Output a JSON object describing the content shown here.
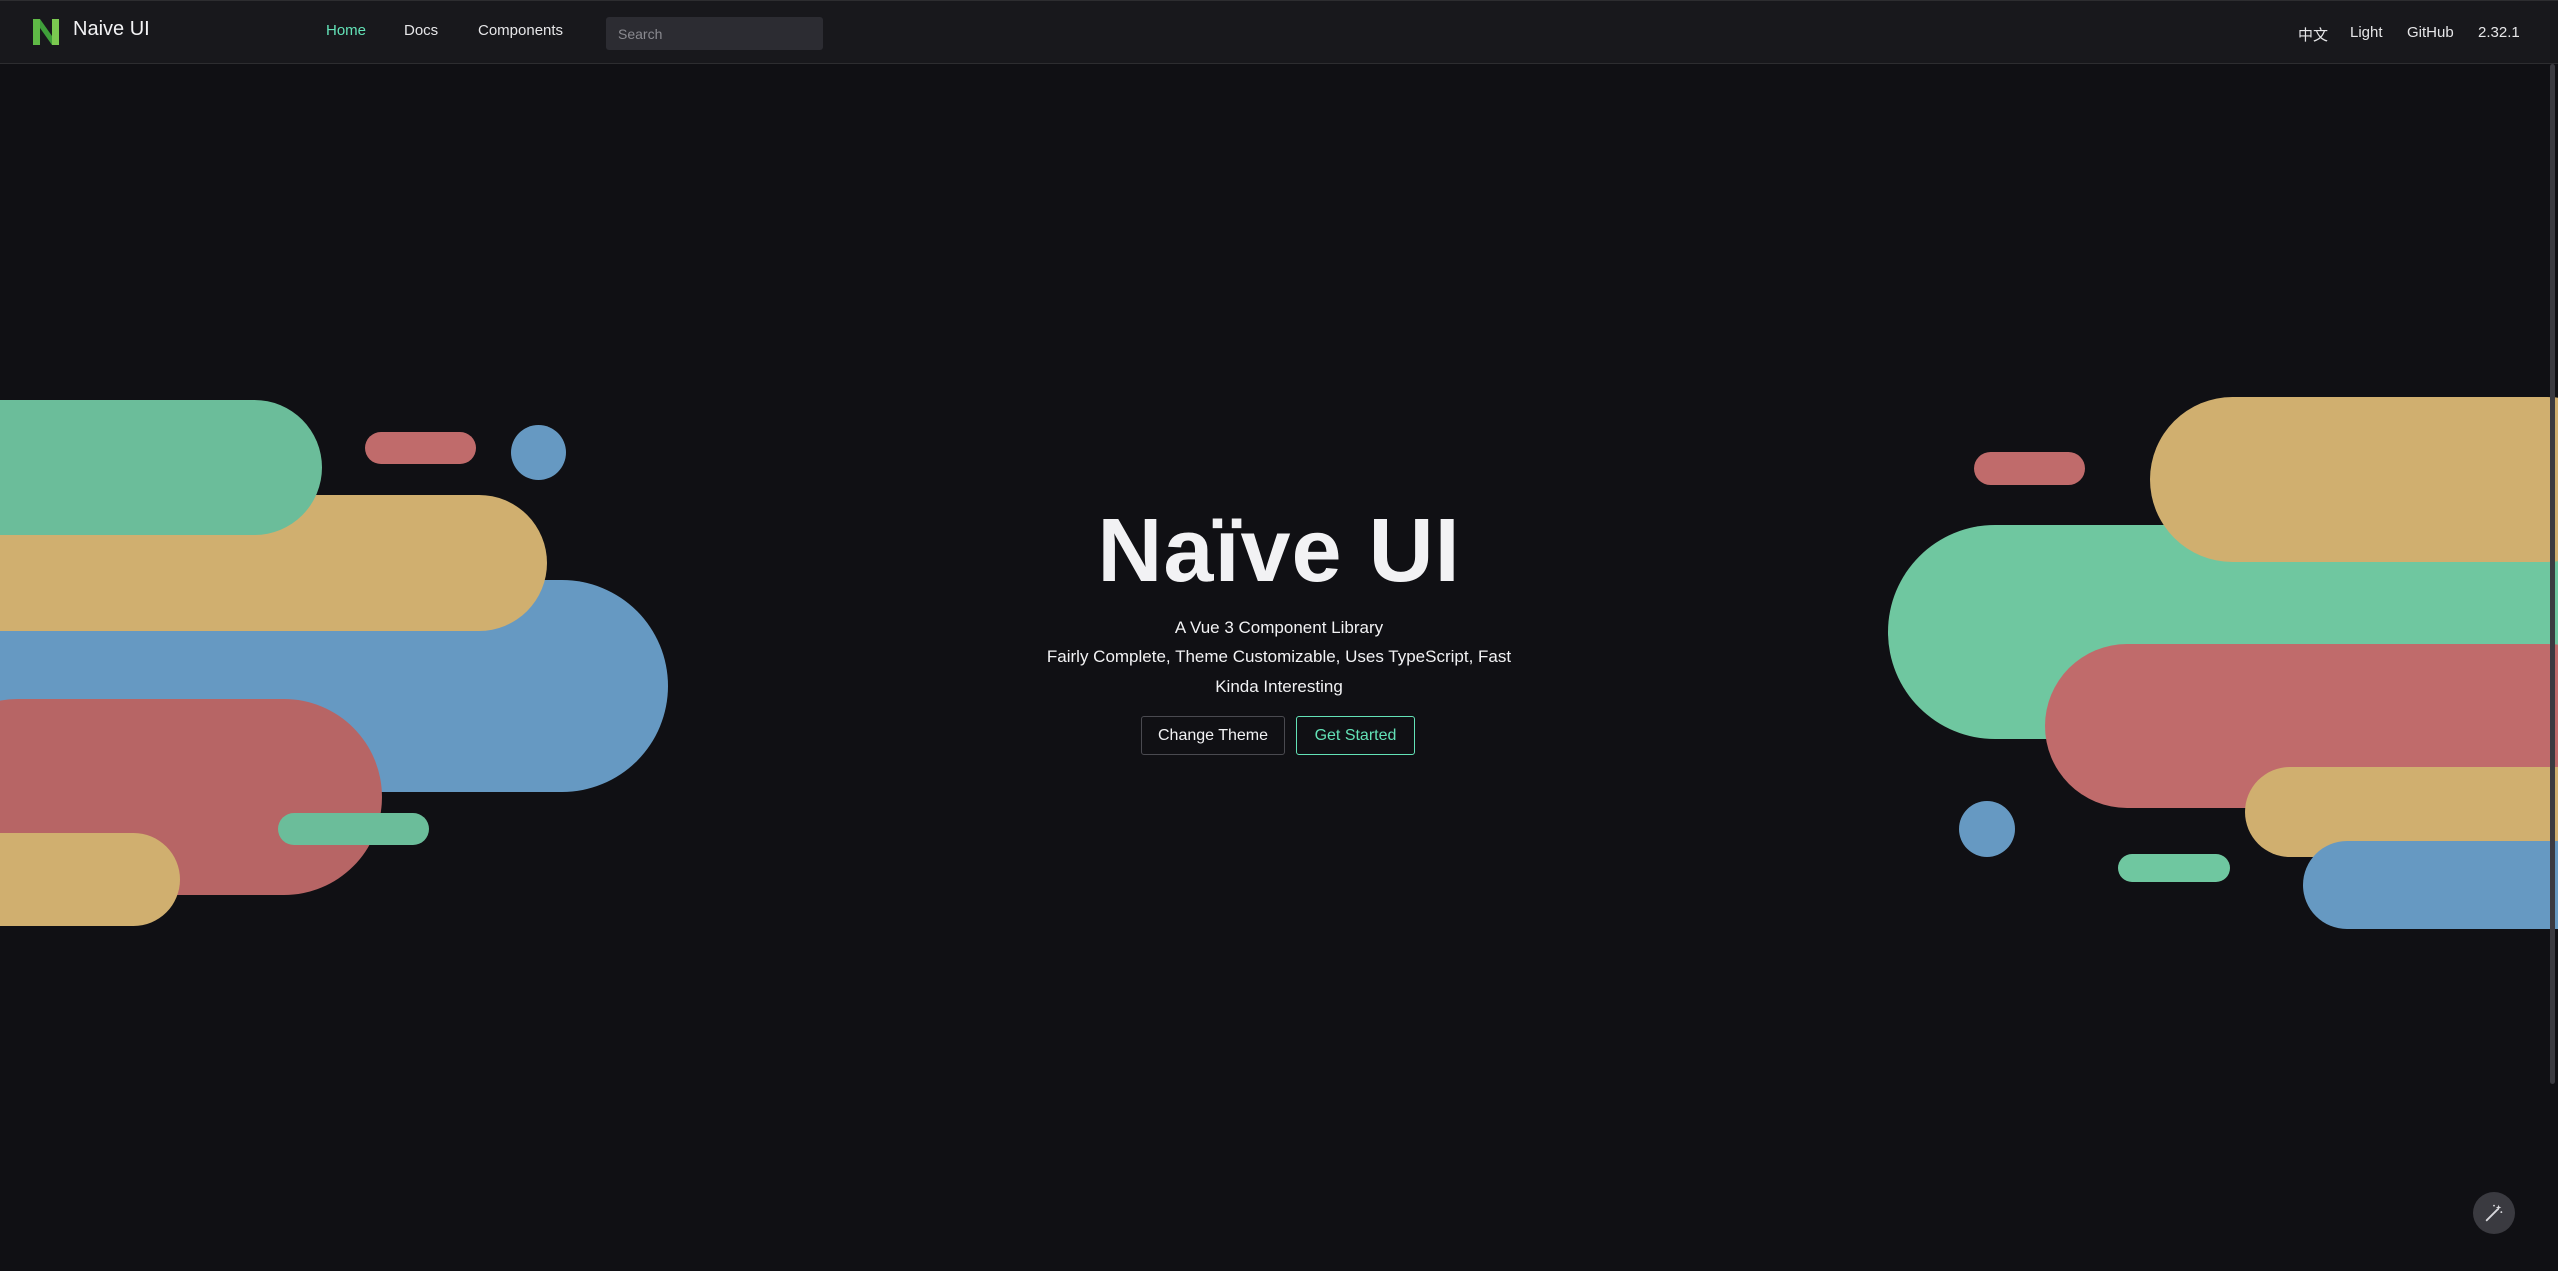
{
  "header": {
    "brand": "Naive UI",
    "nav": {
      "home": "Home",
      "docs": "Docs",
      "components": "Components"
    },
    "search_placeholder": "Search",
    "right": {
      "lang": "中文",
      "theme": "Light",
      "github": "GitHub",
      "version": "2.32.1"
    }
  },
  "hero": {
    "title": "Naïve UI",
    "subtitle1": "A Vue 3 Component Library",
    "subtitle2": "Fairly Complete, Theme Customizable, Uses TypeScript, Fast",
    "subtitle3": "Kinda Interesting",
    "change_theme": "Change Theme",
    "get_started": "Get Started"
  },
  "colors": {
    "accent": "#63e2b7",
    "green": "#6bbd9a",
    "yellow": "#d0af6f",
    "blue": "#6699c2",
    "red": "#c06b6b"
  },
  "icons": {
    "logo": "naive-ui-logo",
    "fab": "magic-wand-icon"
  }
}
